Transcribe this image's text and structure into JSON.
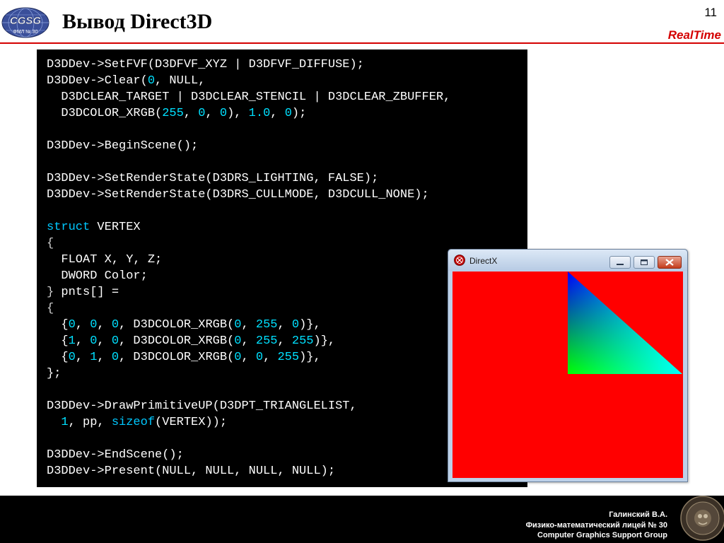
{
  "slide": {
    "title": "Вывод Direct3D",
    "page_number": "11",
    "brand": "RealTime",
    "logo_text": "CGSG",
    "logo_subtext": "ФМЛ № 30"
  },
  "code_lines": [
    [
      [
        "D3DDev->SetFVF(D3DFVF_XYZ | D3DFVF_DIFFUSE);",
        "t"
      ]
    ],
    [
      [
        "D3DDev->Clear(",
        "t"
      ],
      [
        "0",
        "n"
      ],
      [
        ", NULL,",
        "t"
      ]
    ],
    [
      [
        "  D3DCLEAR_TARGET | D3DCLEAR_STENCIL | D3DCLEAR_ZBUFFER,",
        "t"
      ]
    ],
    [
      [
        "  D3DCOLOR_XRGB(",
        "t"
      ],
      [
        "255",
        "n"
      ],
      [
        ", ",
        "t"
      ],
      [
        "0",
        "n"
      ],
      [
        ", ",
        "t"
      ],
      [
        "0",
        "n"
      ],
      [
        "), ",
        "t"
      ],
      [
        "1.0",
        "n"
      ],
      [
        ", ",
        "t"
      ],
      [
        "0",
        "n"
      ],
      [
        ");",
        "t"
      ]
    ],
    [],
    [
      [
        "D3DDev->BeginScene();",
        "t"
      ]
    ],
    [],
    [
      [
        "D3DDev->SetRenderState(D3DRS_LIGHTING, FALSE);",
        "t"
      ]
    ],
    [
      [
        "D3DDev->SetRenderState(D3DRS_CULLMODE, D3DCULL_NONE);",
        "t"
      ]
    ],
    [],
    [
      [
        "struct",
        "k"
      ],
      [
        " VERTEX",
        "t"
      ]
    ],
    [
      [
        "{",
        "p"
      ]
    ],
    [
      [
        "  FLOAT X, Y, Z;",
        "t"
      ]
    ],
    [
      [
        "  DWORD Color;",
        "t"
      ]
    ],
    [
      [
        "}",
        "p"
      ],
      [
        " pnts[] =",
        "t"
      ]
    ],
    [
      [
        "{",
        "p"
      ]
    ],
    [
      [
        "  {",
        "t"
      ],
      [
        "0",
        "n"
      ],
      [
        ", ",
        "t"
      ],
      [
        "0",
        "n"
      ],
      [
        ", ",
        "t"
      ],
      [
        "0",
        "n"
      ],
      [
        ", D3DCOLOR_XRGB(",
        "t"
      ],
      [
        "0",
        "n"
      ],
      [
        ", ",
        "t"
      ],
      [
        "255",
        "n"
      ],
      [
        ", ",
        "t"
      ],
      [
        "0",
        "n"
      ],
      [
        ")},",
        "t"
      ]
    ],
    [
      [
        "  {",
        "t"
      ],
      [
        "1",
        "n"
      ],
      [
        ", ",
        "t"
      ],
      [
        "0",
        "n"
      ],
      [
        ", ",
        "t"
      ],
      [
        "0",
        "n"
      ],
      [
        ", D3DCOLOR_XRGB(",
        "t"
      ],
      [
        "0",
        "n"
      ],
      [
        ", ",
        "t"
      ],
      [
        "255",
        "n"
      ],
      [
        ", ",
        "t"
      ],
      [
        "255",
        "n"
      ],
      [
        ")},",
        "t"
      ]
    ],
    [
      [
        "  {",
        "t"
      ],
      [
        "0",
        "n"
      ],
      [
        ", ",
        "t"
      ],
      [
        "1",
        "n"
      ],
      [
        ", ",
        "t"
      ],
      [
        "0",
        "n"
      ],
      [
        ", D3DCOLOR_XRGB(",
        "t"
      ],
      [
        "0",
        "n"
      ],
      [
        ", ",
        "t"
      ],
      [
        "0",
        "n"
      ],
      [
        ", ",
        "t"
      ],
      [
        "255",
        "n"
      ],
      [
        ")},",
        "t"
      ]
    ],
    [
      [
        "};",
        "t"
      ]
    ],
    [],
    [
      [
        "D3DDev->DrawPrimitiveUP(D3DPT_TRIANGLELIST,",
        "t"
      ]
    ],
    [
      [
        "  ",
        "t"
      ],
      [
        "1",
        "n"
      ],
      [
        ", pp, ",
        "t"
      ],
      [
        "sizeof",
        "k"
      ],
      [
        "(VERTEX));",
        "t"
      ]
    ],
    [],
    [
      [
        "D3DDev->EndScene();",
        "t"
      ]
    ],
    [
      [
        "D3DDev->Present(NULL, NULL, NULL, NULL);",
        "t"
      ]
    ]
  ],
  "dx_window": {
    "title": "DirectX",
    "icon": "directx-app-icon",
    "clear_color": "#ff0000",
    "triangle_colors": [
      "#00ff00",
      "#00ffff",
      "#0000ff"
    ]
  },
  "footer": {
    "author": "Галинский В.А.",
    "school": "Физико-математический лицей № 30",
    "group": "Computer Graphics Support Group"
  },
  "colors": {
    "brand_red": "#d40000",
    "code_bg": "#000000",
    "code_text": "#ffffff",
    "code_keyword": "#00c8ff",
    "code_number": "#00e0ff"
  }
}
